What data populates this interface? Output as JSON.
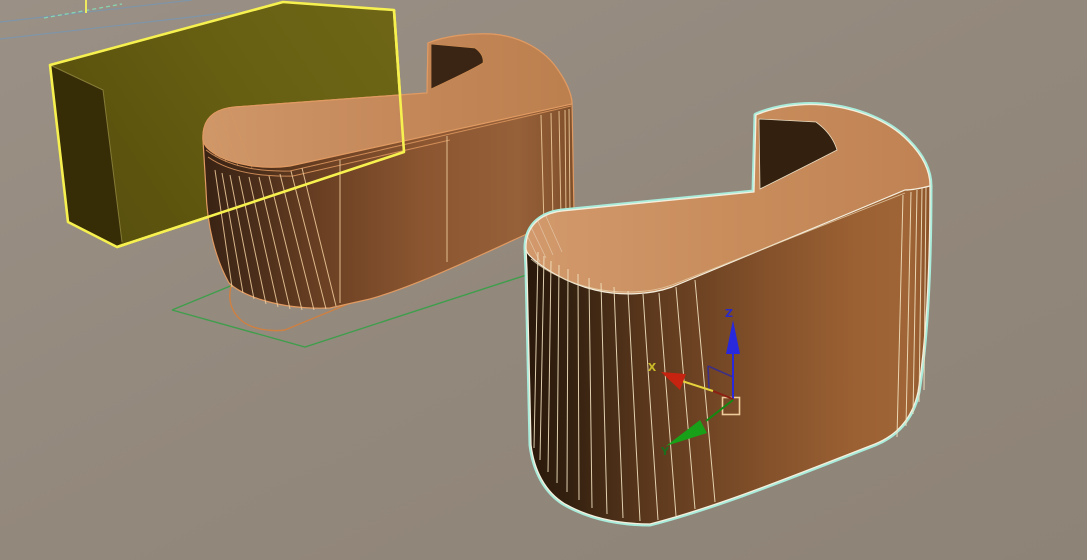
{
  "app": {
    "name": "3D modeling viewport",
    "view": "Perspective"
  },
  "viewport": {
    "background": "#92877b",
    "grid_line_color": "#7e95a9",
    "grid_dashed_color": "#86d4b2",
    "grid_tick_color": "#eeea60"
  },
  "objects": {
    "box": {
      "label": "box-wireframe-yellow",
      "edge_color": "#f7f150",
      "top_face_color": "#6b6313",
      "end_face_color": "#362d07",
      "selected": false
    },
    "desk_middle": {
      "label": "curved-desk-unselected",
      "edge_color": "#e09a62",
      "counter_color": "#c78b5c",
      "wall_dark_color": "#3a2314",
      "wall_light_color": "#96603a",
      "inner_face_color": "#3a2413",
      "wire_color": "#f2cf9f",
      "selected": false
    },
    "desk_selected": {
      "label": "curved-desk-selected",
      "selection_outline_color": "#a8ecdb",
      "edge_color": "#f5eedd",
      "counter_color": "#c98e5e",
      "wall_dark_color": "#2a180b",
      "wall_light_color": "#9c6133",
      "inner_face_color": "#33200e",
      "wire_color": "#f2e2c0",
      "selected": true
    },
    "spline_green": {
      "label": "ground-spline-sharp",
      "color": "#3f9e4c"
    },
    "spline_orange": {
      "label": "ground-spline-rounded",
      "color": "#d08040"
    }
  },
  "gizmo": {
    "type": "move",
    "x_label": "X",
    "y_label": "Y",
    "z_label": "Z",
    "x_color": "#c62310",
    "y_color": "#18a018",
    "z_color": "#2828dd",
    "x_stem_dark": "#8a2013",
    "active_axis": "X",
    "active_axis_color": "#e6d23c",
    "x_label_color": "#c9b929",
    "y_label_color": "#1c6e1c",
    "z_label_color": "#2a2ac8",
    "plane_handle_color": "#3d2f85",
    "pivot_square_color": "#eecb9b"
  }
}
